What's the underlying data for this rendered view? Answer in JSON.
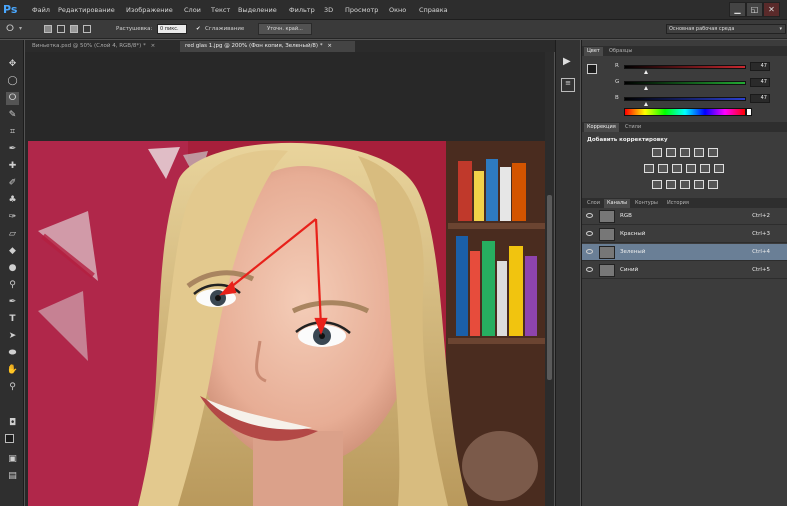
{
  "menubar": {
    "logo": "Ps",
    "items": [
      "Файл",
      "Редактирование",
      "Изображение",
      "Слои",
      "Текст",
      "Выделение",
      "Фильтр",
      "3D",
      "Просмотр",
      "Окно",
      "Справка"
    ],
    "window_buttons": [
      "▁",
      "◱",
      "✕"
    ]
  },
  "options": {
    "feather_label": "Растушевка:",
    "feather_value": "0 пикс.",
    "antialias_label": "Сглаживание",
    "refine_button": "Уточн. край...",
    "workspace": "Основная рабочая среда"
  },
  "tabs": [
    {
      "label": "Виньетка.psd @ 50% (Слой 4, RGB/8*) *"
    },
    {
      "label": "red glas 1.jpg @ 200% (Фон копия, Зеленый/8) *"
    }
  ],
  "color_panel": {
    "tabs": [
      "Цвет",
      "Образцы"
    ],
    "channels": [
      {
        "label": "R",
        "value": "47",
        "color": "#c8282f",
        "level": 0.18
      },
      {
        "label": "G",
        "value": "47",
        "color": "#22aa33",
        "level": 0.18
      },
      {
        "label": "B",
        "value": "47",
        "color": "#2a3fd0",
        "level": 0.18
      }
    ]
  },
  "adjustments_panel": {
    "tabs": [
      "Коррекция",
      "Стили"
    ],
    "heading": "Добавить корректировку"
  },
  "channels_panel": {
    "tabs": [
      "Слои",
      "Каналы",
      "Контуры",
      "История"
    ],
    "rows": [
      {
        "name": "RGB",
        "shortcut": "Ctrl+2"
      },
      {
        "name": "Красный",
        "shortcut": "Ctrl+3"
      },
      {
        "name": "Зеленый",
        "shortcut": "Ctrl+4"
      },
      {
        "name": "Синий",
        "shortcut": "Ctrl+5"
      }
    ]
  },
  "colors": {
    "fg": "#1d1d1d",
    "bg": "#e01a1a",
    "accent_arrow": "#e8211a",
    "selected_row": "#6a7f96"
  }
}
